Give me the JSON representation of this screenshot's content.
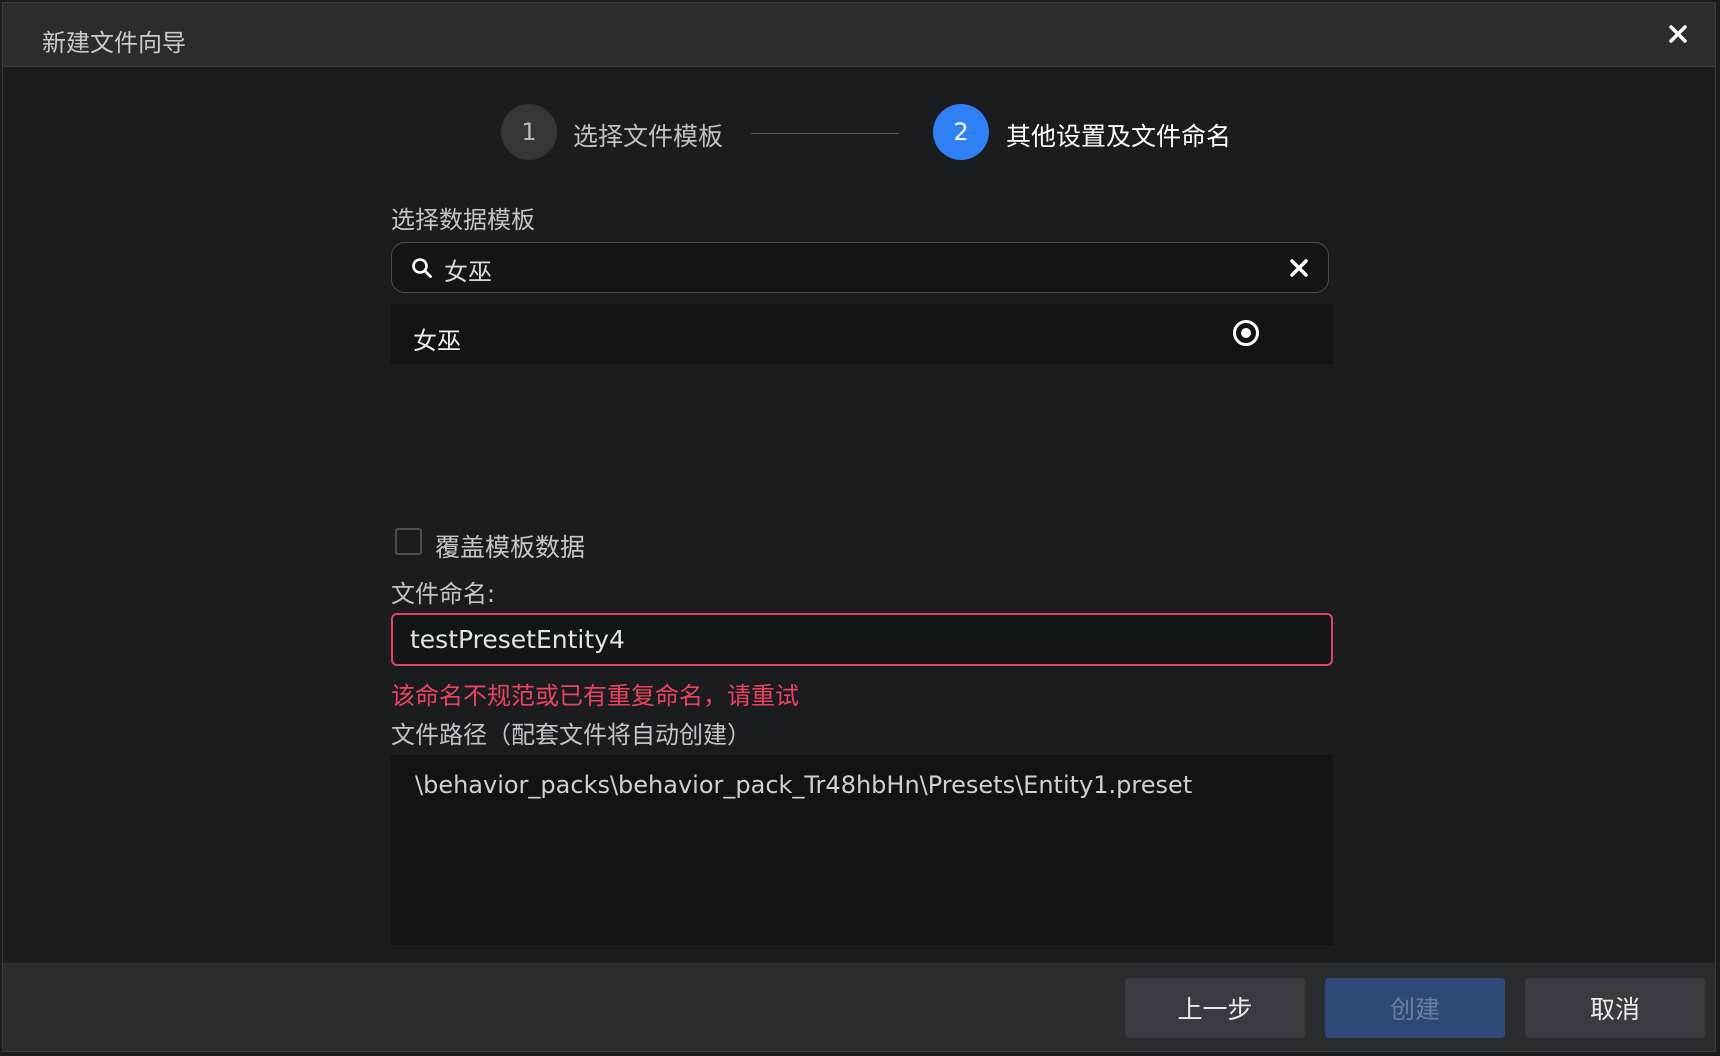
{
  "dialog": {
    "title": "新建文件向导"
  },
  "steps": [
    {
      "number": "1",
      "label": "选择文件模板",
      "active": false
    },
    {
      "number": "2",
      "label": "其他设置及文件命名",
      "active": true
    }
  ],
  "template": {
    "section_label": "选择数据模板",
    "search_value": "女巫",
    "result_label": "女巫",
    "result_selected": true
  },
  "override": {
    "label": "覆盖模板数据",
    "checked": false
  },
  "file_name": {
    "label": "文件命名:",
    "value": "testPresetEntity4",
    "error": "该命名不规范或已有重复命名，请重试"
  },
  "file_path": {
    "label": "文件路径（配套文件将自动创建）",
    "value": "\\behavior_packs\\behavior_pack_Tr48hbHn\\Presets\\Entity1.preset"
  },
  "footer": {
    "prev_label": "上一步",
    "create_label": "创建",
    "cancel_label": "取消"
  },
  "colors": {
    "accent": "#2f80f5",
    "error": "#e9445f",
    "background": "#1b1c1f",
    "titlebar": "#2b2c30"
  }
}
